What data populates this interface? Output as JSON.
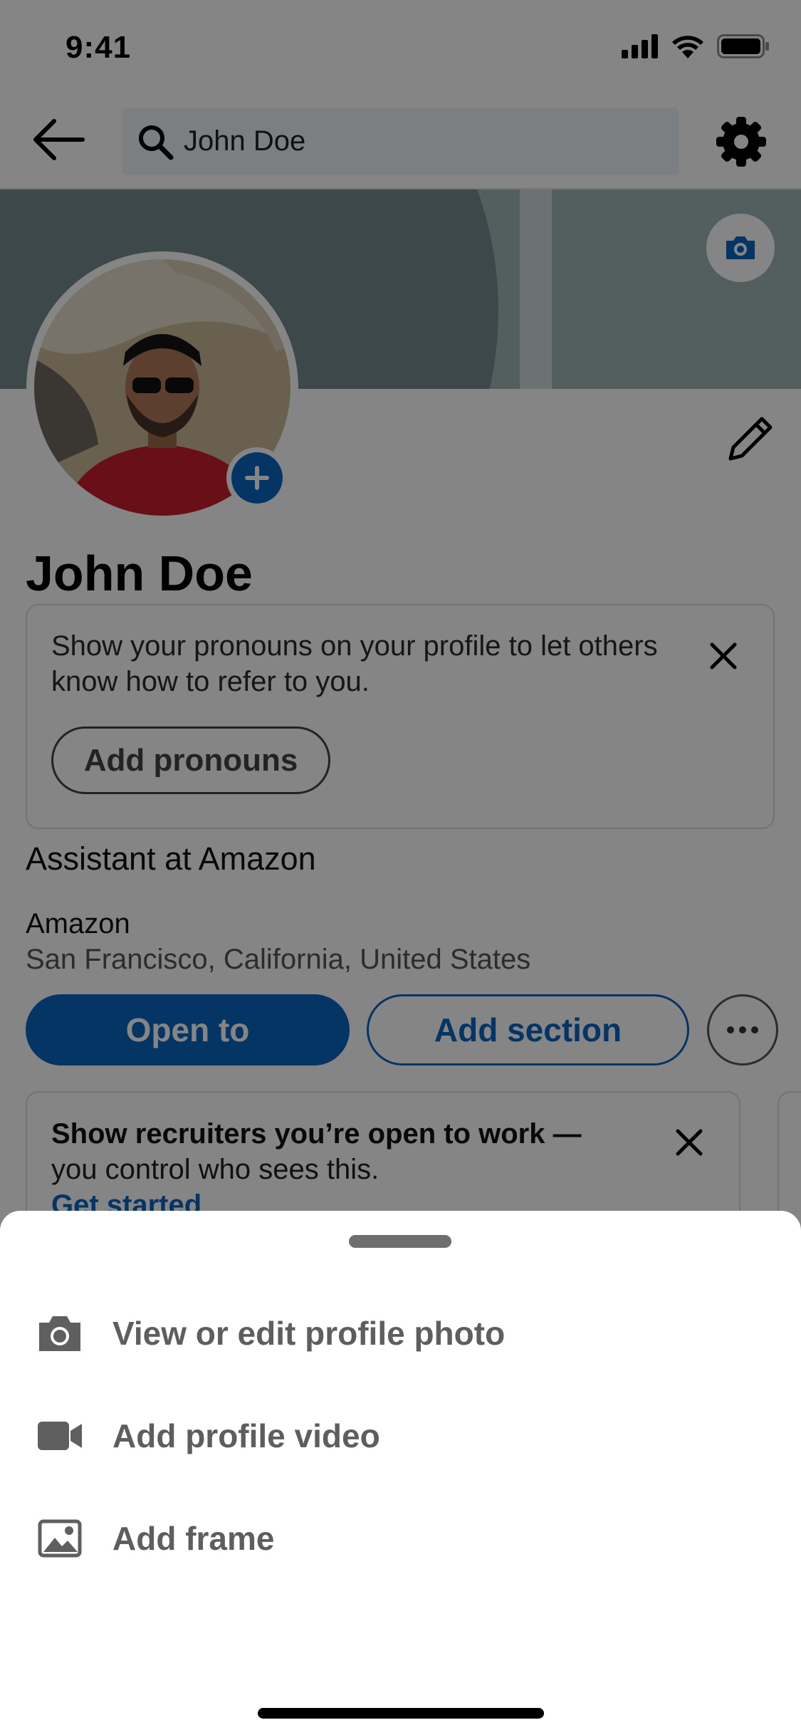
{
  "status_bar": {
    "time": "9:41"
  },
  "header": {
    "search_value": "John Doe"
  },
  "profile": {
    "name": "John Doe",
    "headline": "Assistant at Amazon",
    "company": "Amazon",
    "location": "San Francisco, California, United States"
  },
  "pronouns_card": {
    "text": "Show your pronouns on your profile to let others know how to refer to you.",
    "button_label": "Add pronouns"
  },
  "actions": {
    "open_to_label": "Open to",
    "add_section_label": "Add section"
  },
  "recruiter_card": {
    "bold_text": "Show recruiters you’re open to work —",
    "text": "you control who sees this.",
    "link_text": "Get started"
  },
  "bottom_sheet": {
    "items": [
      {
        "icon": "camera-icon",
        "label": "View or edit profile photo"
      },
      {
        "icon": "video-camera-icon",
        "label": "Add profile video"
      },
      {
        "icon": "image-frame-icon",
        "label": "Add frame"
      }
    ]
  },
  "colors": {
    "brand_blue": "#0a66c2",
    "overlay": "rgba(0,0,0,0.48)"
  }
}
